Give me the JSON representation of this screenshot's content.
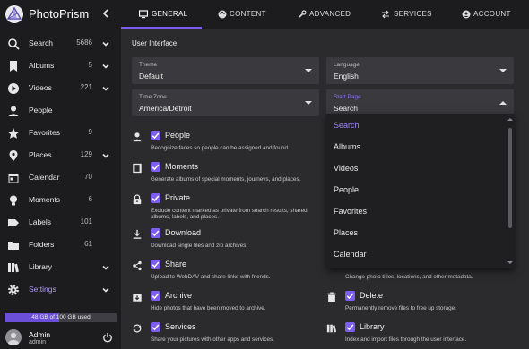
{
  "app": {
    "name": "PhotoPrism"
  },
  "sidebar": {
    "items": [
      {
        "label": "Search",
        "count": "5686",
        "icon": "search-icon",
        "chevron": true
      },
      {
        "label": "Albums",
        "count": "5",
        "icon": "bookmark-icon",
        "chevron": true
      },
      {
        "label": "Videos",
        "count": "221",
        "icon": "play-circle-icon",
        "chevron": true
      },
      {
        "label": "People",
        "count": "",
        "icon": "person-icon",
        "chevron": false
      },
      {
        "label": "Favorites",
        "count": "9",
        "icon": "star-icon",
        "chevron": false
      },
      {
        "label": "Places",
        "count": "129",
        "icon": "place-icon",
        "chevron": true
      },
      {
        "label": "Calendar",
        "count": "70",
        "icon": "calendar-icon",
        "chevron": false
      },
      {
        "label": "Moments",
        "count": "6",
        "icon": "lightbulb-icon",
        "chevron": false
      },
      {
        "label": "Labels",
        "count": "101",
        "icon": "label-icon",
        "chevron": false
      },
      {
        "label": "Folders",
        "count": "61",
        "icon": "folder-icon",
        "chevron": false
      },
      {
        "label": "Library",
        "count": "",
        "icon": "library-icon",
        "chevron": true
      },
      {
        "label": "Settings",
        "count": "",
        "icon": "settings-icon",
        "chevron": true,
        "active": true
      }
    ],
    "storage": {
      "text": "48 GB of 100 GB used",
      "used_fraction": 0.48
    },
    "user": {
      "name": "Admin",
      "role": "admin"
    }
  },
  "tabs": [
    {
      "label": "GENERAL",
      "icon": "monitor-icon",
      "active": true
    },
    {
      "label": "CONTENT",
      "icon": "palette-icon",
      "active": false
    },
    {
      "label": "ADVANCED",
      "icon": "wrench-icon",
      "active": false
    },
    {
      "label": "SERVICES",
      "icon": "swap-icon",
      "active": false
    },
    {
      "label": "ACCOUNT",
      "icon": "account-icon",
      "active": false
    }
  ],
  "main": {
    "section_title": "User Interface",
    "fields": {
      "theme": {
        "label": "Theme",
        "value": "Default"
      },
      "language": {
        "label": "Language",
        "value": "English"
      },
      "timezone": {
        "label": "Time Zone",
        "value": "America/Detroit"
      },
      "start_page": {
        "label": "Start Page",
        "value": "Search"
      }
    },
    "options_left": [
      {
        "label": "People",
        "desc": "Recognize faces so people can be assigned and found.",
        "icon": "person-icon"
      },
      {
        "label": "Moments",
        "desc": "Generate albums of special moments, journeys, and places.",
        "icon": "filmstrip-icon"
      },
      {
        "label": "Private",
        "desc": "Exclude content marked as private from search results, shared albums, labels, and places.",
        "icon": "lock-icon"
      },
      {
        "label": "Download",
        "desc": "Download single files and zip archives.",
        "icon": "download-icon"
      },
      {
        "label": "Share",
        "desc": "Upload to WebDAV and share links with friends.",
        "icon": "share-icon"
      },
      {
        "label": "Archive",
        "desc": "Hide photos that have been moved to archive.",
        "icon": "archive-icon"
      },
      {
        "label": "Services",
        "desc": "Share your pictures with other apps and services.",
        "icon": "sync-icon"
      }
    ],
    "options_right": [
      {
        "label": "",
        "desc": "Change photo titles, locations, and other metadata.",
        "icon": ""
      },
      {
        "label": "Delete",
        "desc": "Permanently remove files to free up storage.",
        "icon": "trash-icon"
      },
      {
        "label": "Library",
        "desc": "Index and import files through the user interface.",
        "icon": "library-icon"
      }
    ]
  },
  "start_page_menu": {
    "options": [
      "Search",
      "Albums",
      "Videos",
      "People",
      "Favorites",
      "Places",
      "Calendar"
    ],
    "selected": "Search"
  },
  "colors": {
    "accent": "#7c5ff0",
    "sidebar_bg": "#1c1c1f",
    "main_bg": "#2b2b2e",
    "field_bg": "#3a3a3e"
  }
}
